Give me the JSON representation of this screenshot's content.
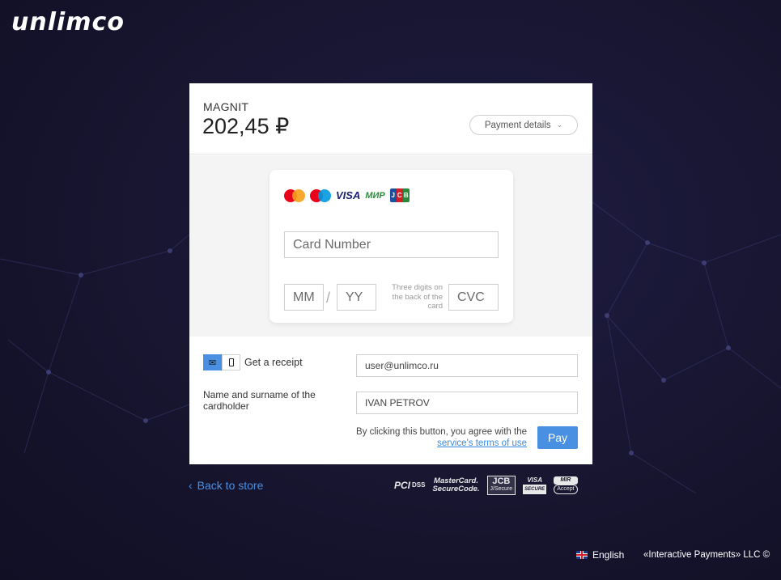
{
  "brand": {
    "logo_text": "unlimco"
  },
  "header": {
    "merchant": "MAGNIT",
    "amount": "202,45 ₽",
    "details_label": "Payment details"
  },
  "card_form": {
    "brands": [
      "mastercard-logo",
      "maestro-logo",
      "VISA",
      "МИР",
      "JCB"
    ],
    "card_number_placeholder": "Card Number",
    "month_placeholder": "MM",
    "year_placeholder": "YY",
    "separator": "/",
    "cvc_hint": "Three digits on the back of the card",
    "cvc_placeholder": "CVC"
  },
  "receipt": {
    "label": "Get a receipt",
    "email_value": "user@unlimco.ru",
    "active_channel": "email"
  },
  "cardholder": {
    "label": "Name and surname of the cardholder",
    "value": "IVAN PETROV"
  },
  "terms": {
    "text": "By clicking this button, you agree with the",
    "link": "service's terms of use"
  },
  "pay_label": "Pay",
  "back_label": "Back to store",
  "security_badges": {
    "pci": "PCI",
    "dss": "DSS",
    "mastercard_line1": "MasterCard.",
    "mastercard_line2": "SecureCode.",
    "jcb_line1": "JCB",
    "jcb_line2": "J/Secure",
    "visa_line1": "VISA",
    "visa_line2": "SECURE",
    "mir_line1": "MIR",
    "mir_line2": "Accept"
  },
  "footer": {
    "language": "English",
    "copyright": "«Interactive Payments» LLC ©"
  },
  "colors": {
    "accent": "#4a90e2",
    "background": "#17152f",
    "mastercard_red": "#eb001b",
    "mastercard_orange": "#f79e1b",
    "maestro_blue": "#0099df",
    "visa_blue": "#1a1f71",
    "mir_green": "#2a8a3b"
  }
}
